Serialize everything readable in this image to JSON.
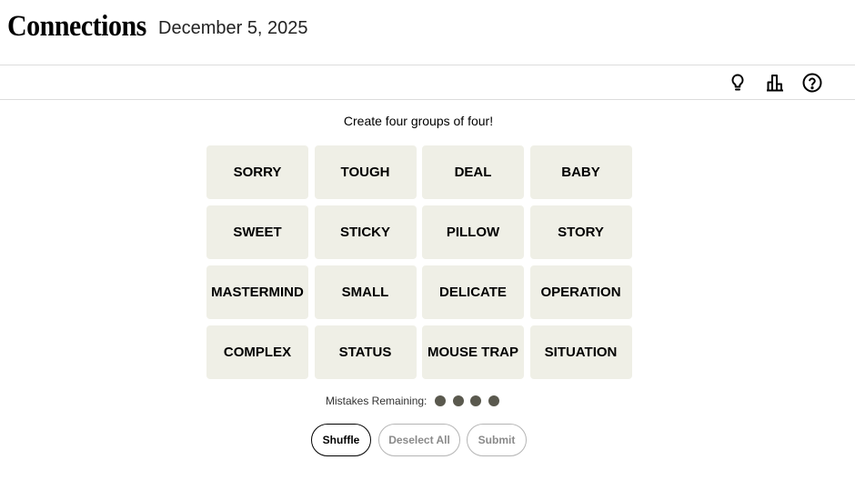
{
  "header": {
    "title": "Connections",
    "date": "December 5, 2025"
  },
  "toolbar": {
    "icons": [
      "lightbulb-icon",
      "stats-icon",
      "help-icon"
    ]
  },
  "instructions": "Create four groups of four!",
  "tiles": [
    "SORRY",
    "TOUGH",
    "DEAL",
    "BABY",
    "SWEET",
    "STICKY",
    "PILLOW",
    "STORY",
    "MASTERMIND",
    "SMALL",
    "DELICATE",
    "OPERATION",
    "COMPLEX",
    "STATUS",
    "MOUSE TRAP",
    "SITUATION"
  ],
  "mistakes": {
    "label": "Mistakes Remaining:",
    "remaining": 4
  },
  "buttons": {
    "shuffle": "Shuffle",
    "deselect": "Deselect All",
    "submit": "Submit"
  },
  "colors": {
    "tile_bg": "#efefe6",
    "dot": "#5a594e"
  }
}
